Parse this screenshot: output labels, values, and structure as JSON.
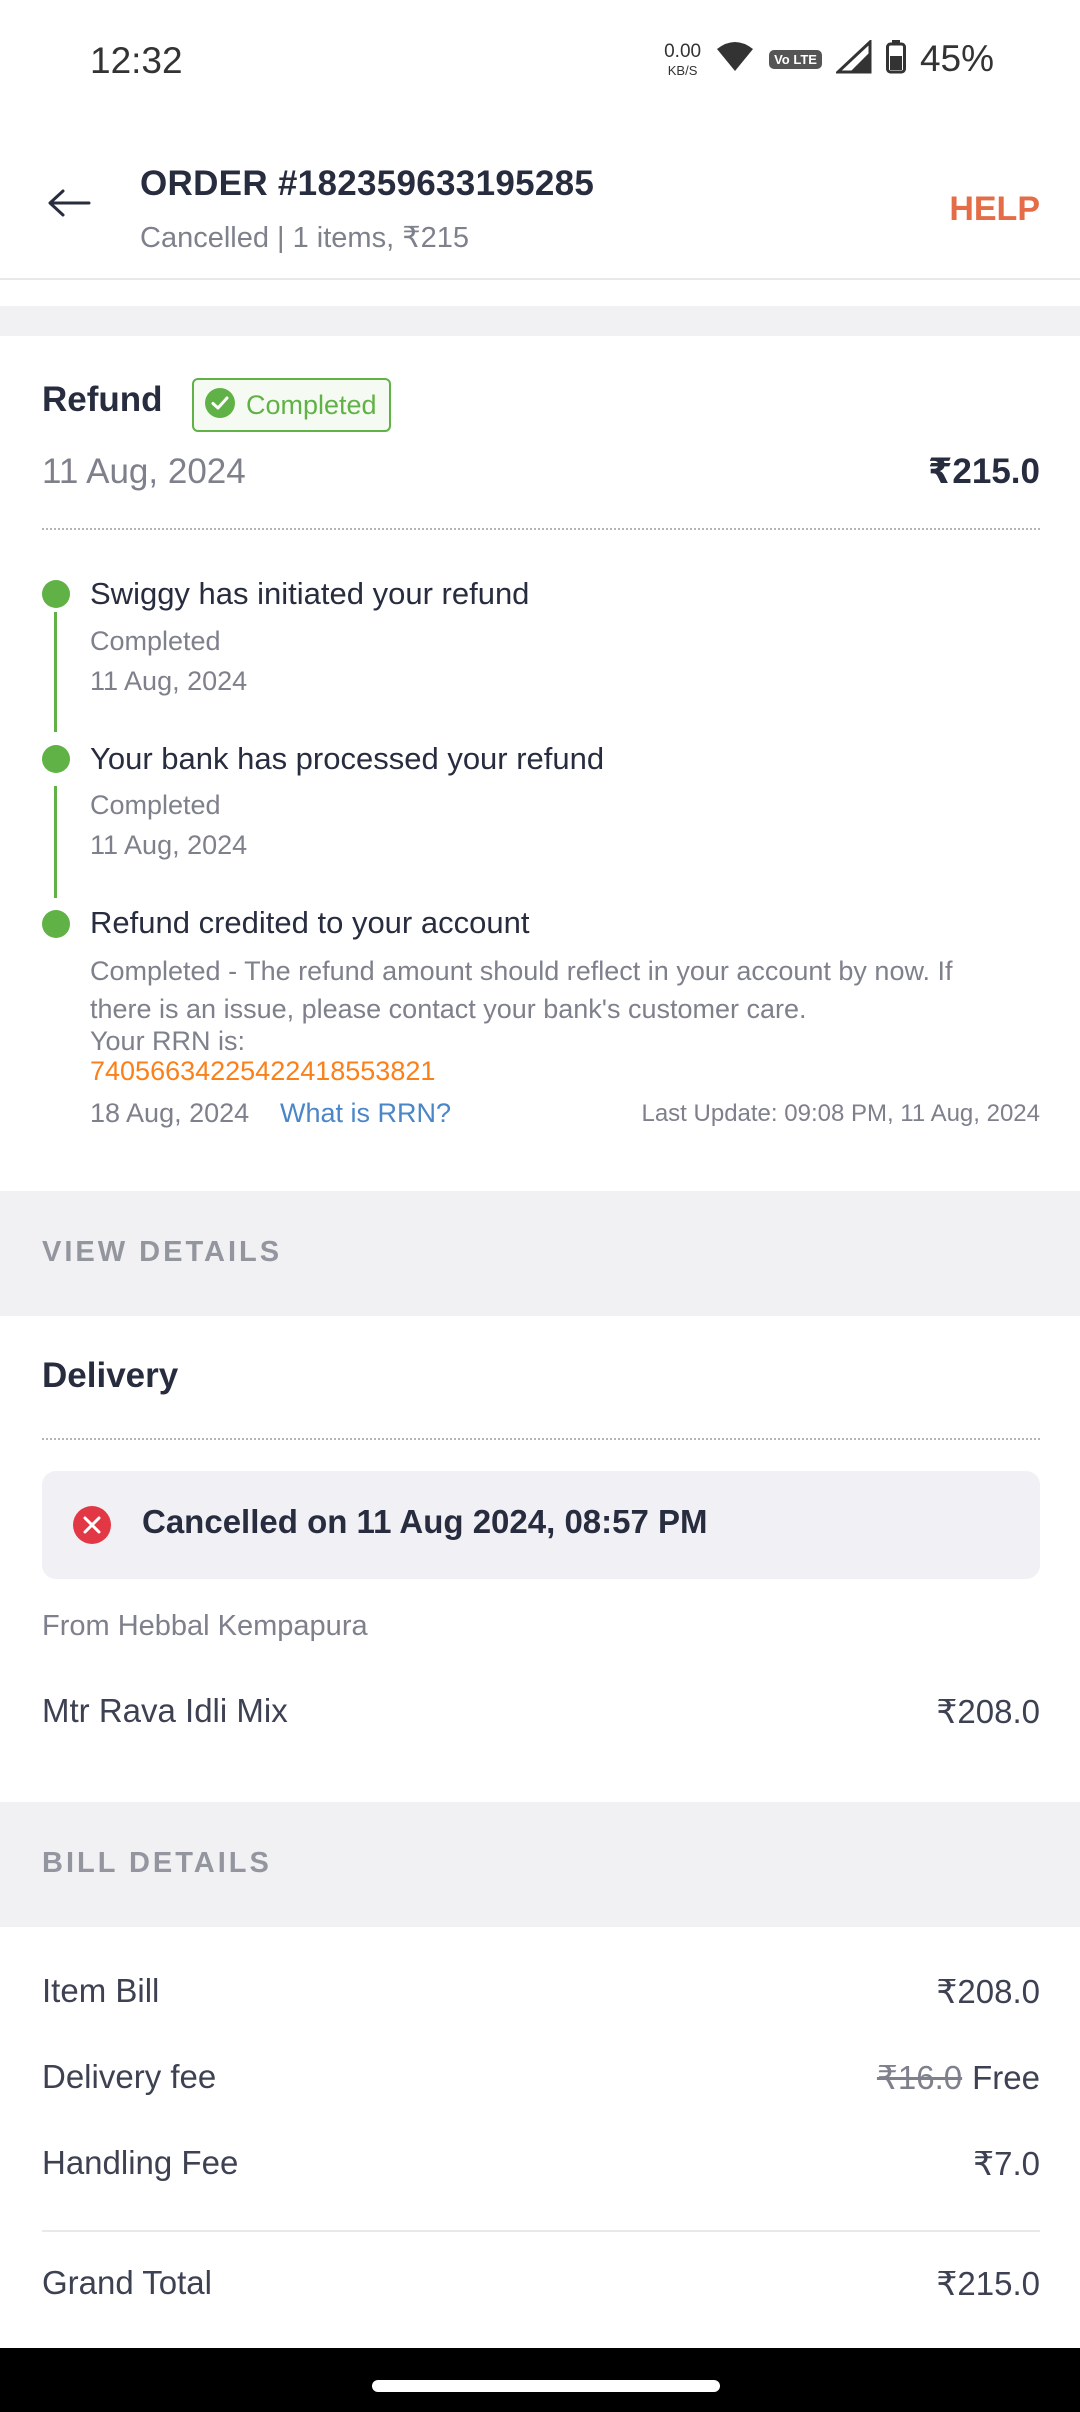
{
  "status_bar": {
    "time": "12:32",
    "net_speed_value": "0.00",
    "net_speed_unit": "KB/S",
    "volte": "Vo LTE",
    "battery": "45%"
  },
  "header": {
    "title": "ORDER #182359633195285",
    "subtitle": "Cancelled | 1 items, ₹215",
    "help": "HELP"
  },
  "refund": {
    "title": "Refund",
    "badge": "Completed",
    "date": "11 Aug, 2024",
    "amount": "₹215.0",
    "timeline": [
      {
        "title": "Swiggy has initiated your refund",
        "status": "Completed",
        "date": "11 Aug, 2024"
      },
      {
        "title": "Your bank has processed your refund",
        "status": "Completed",
        "date": "11 Aug, 2024"
      },
      {
        "title": "Refund credited to your account",
        "status": "Completed - The refund amount should reflect in your account by now. If there is an issue, please contact your bank's customer care.",
        "rrn_label": "Your RRN is:",
        "rrn": "740566342254224185538​21",
        "date": "18 Aug, 2024"
      }
    ],
    "rrn_link": "What is RRN?",
    "last_update": "Last Update: 09:08 PM, 11 Aug, 2024"
  },
  "view_details": {
    "label": "VIEW DETAILS"
  },
  "delivery": {
    "title": "Delivery",
    "cancel_text": "Cancelled on 11 Aug 2024, 08:57 PM",
    "from": "From Hebbal Kempapura",
    "item_name": "Mtr Rava Idli Mix",
    "item_price": "₹208.0"
  },
  "bill_details": {
    "label": "BILL DETAILS",
    "item_bill_label": "Item Bill",
    "item_bill_value": "₹208.0",
    "delivery_fee_label": "Delivery fee",
    "delivery_fee_original": "₹16.0",
    "delivery_fee_value": "Free",
    "handling_fee_label": "Handling Fee",
    "handling_fee_value": "₹7.0",
    "grand_total_label": "Grand Total",
    "grand_total_value": "₹215.0"
  },
  "colors": {
    "accent_orange": "#e46d47",
    "success_green": "#60b246",
    "rrn_orange": "#fc8019",
    "link_blue": "#4a86c8",
    "cancel_red": "#e23744"
  }
}
